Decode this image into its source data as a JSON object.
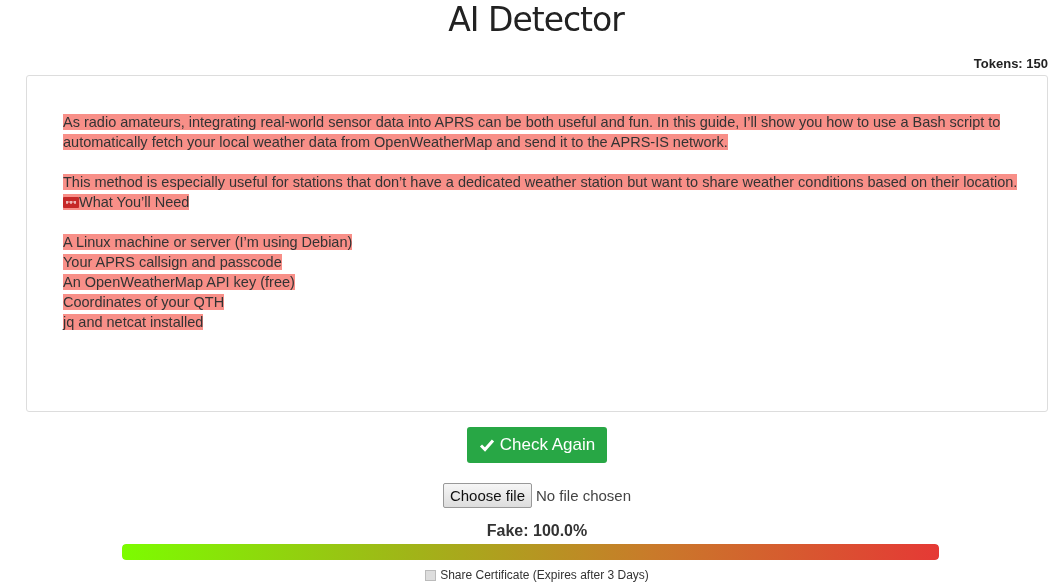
{
  "title": "AI Detector",
  "tokens": "Tokens: 150",
  "paragraphs": [
    {
      "lines": [
        {
          "text": "As radio amateurs, integrating real-world sensor data into APRS can be both useful and fun. In this guide, I’ll show you how to use a Bash script to",
          "highlighted": true,
          "kind": "plain"
        },
        {
          "text": "automatically fetch your local weather data from OpenWeatherMap and send it to the APRS-IS network.",
          "highlighted": true,
          "kind": "plain"
        }
      ]
    },
    {
      "lines": [
        {
          "text": "This method is especially useful for stations that don’t have a dedicated weather station but want to share weather conditions based on their location.",
          "highlighted": true,
          "kind": "plain"
        },
        {
          "text": "What You’ll Need",
          "highlighted": true,
          "kind": "emoji"
        }
      ]
    },
    {
      "lines": [
        {
          "text": "A Linux machine or server (I’m using Debian)",
          "highlighted": true,
          "kind": "plain"
        },
        {
          "text": "Your APRS callsign and passcode",
          "highlighted": true,
          "kind": "plain"
        },
        {
          "text": "An OpenWeatherMap API key (free)",
          "highlighted": true,
          "kind": "plain"
        },
        {
          "text": "Coordinates of your QTH",
          "highlighted": true,
          "kind": "plain"
        },
        {
          "text": "jq and netcat installed",
          "highlighted": true,
          "kind": "plain"
        }
      ]
    }
  ],
  "check_button": "Check Again",
  "file_input": {
    "button": "Choose file",
    "status": "No file chosen"
  },
  "result": {
    "label": "Fake: 100.0%",
    "level": 1.0
  },
  "share": {
    "label": "Share Certificate (Expires after 3 Days)",
    "checked": false
  }
}
